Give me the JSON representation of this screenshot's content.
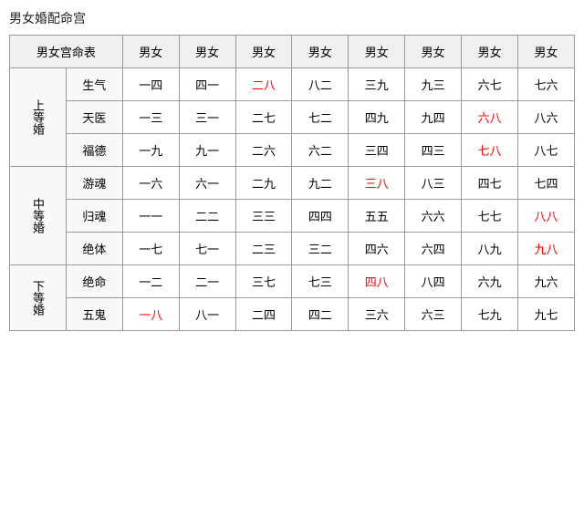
{
  "title": "男女婚配命宫",
  "table": {
    "topHeader": [
      "男女宫命表",
      "男女",
      "男女",
      "男女",
      "男女",
      "男女",
      "男女",
      "男女",
      "男女"
    ],
    "groups": [
      {
        "groupLabel": "上等婚",
        "rows": [
          {
            "rowLabel": "生气",
            "cells": [
              {
                "text": "一四",
                "red": false
              },
              {
                "text": "四一",
                "red": false
              },
              {
                "text": "二八",
                "red": true
              },
              {
                "text": "八二",
                "red": false
              },
              {
                "text": "三九",
                "red": false
              },
              {
                "text": "九三",
                "red": false
              },
              {
                "text": "六七",
                "red": false
              },
              {
                "text": "七六",
                "red": false
              }
            ]
          },
          {
            "rowLabel": "天医",
            "cells": [
              {
                "text": "一三",
                "red": false
              },
              {
                "text": "三一",
                "red": false
              },
              {
                "text": "二七",
                "red": false
              },
              {
                "text": "七二",
                "red": false
              },
              {
                "text": "四九",
                "red": false
              },
              {
                "text": "九四",
                "red": false
              },
              {
                "text": "六八",
                "red": true
              },
              {
                "text": "八六",
                "red": false
              }
            ]
          },
          {
            "rowLabel": "福德",
            "cells": [
              {
                "text": "一九",
                "red": false
              },
              {
                "text": "九一",
                "red": false
              },
              {
                "text": "二六",
                "red": false
              },
              {
                "text": "六二",
                "red": false
              },
              {
                "text": "三四",
                "red": false
              },
              {
                "text": "四三",
                "red": false
              },
              {
                "text": "七八",
                "red": true
              },
              {
                "text": "八七",
                "red": false
              }
            ]
          }
        ]
      },
      {
        "groupLabel": "中等婚",
        "rows": [
          {
            "rowLabel": "游魂",
            "cells": [
              {
                "text": "一六",
                "red": false
              },
              {
                "text": "六一",
                "red": false
              },
              {
                "text": "二九",
                "red": false
              },
              {
                "text": "九二",
                "red": false
              },
              {
                "text": "三八",
                "red": true
              },
              {
                "text": "八三",
                "red": false
              },
              {
                "text": "四七",
                "red": false
              },
              {
                "text": "七四",
                "red": false
              }
            ]
          },
          {
            "rowLabel": "归魂",
            "cells": [
              {
                "text": "一一",
                "red": false
              },
              {
                "text": "二二",
                "red": false
              },
              {
                "text": "三三",
                "red": false
              },
              {
                "text": "四四",
                "red": false
              },
              {
                "text": "五五",
                "red": false
              },
              {
                "text": "六六",
                "red": false
              },
              {
                "text": "七七",
                "red": false
              },
              {
                "text": "八八",
                "red": true
              }
            ]
          },
          {
            "rowLabel": "绝体",
            "cells": [
              {
                "text": "一七",
                "red": false
              },
              {
                "text": "七一",
                "red": false
              },
              {
                "text": "二三",
                "red": false
              },
              {
                "text": "三二",
                "red": false
              },
              {
                "text": "四六",
                "red": false
              },
              {
                "text": "六四",
                "red": false
              },
              {
                "text": "八九",
                "red": false
              },
              {
                "text": "九八",
                "red": true
              }
            ]
          }
        ]
      },
      {
        "groupLabel": "下等婚",
        "rows": [
          {
            "rowLabel": "绝命",
            "cells": [
              {
                "text": "一二",
                "red": false
              },
              {
                "text": "二一",
                "red": false
              },
              {
                "text": "三七",
                "red": false
              },
              {
                "text": "七三",
                "red": false
              },
              {
                "text": "四八",
                "red": true
              },
              {
                "text": "八四",
                "red": false
              },
              {
                "text": "六九",
                "red": false
              },
              {
                "text": "九六",
                "red": false
              }
            ]
          },
          {
            "rowLabel": "五鬼",
            "cells": [
              {
                "text": "一八",
                "red": true
              },
              {
                "text": "八一",
                "red": false
              },
              {
                "text": "二四",
                "red": false
              },
              {
                "text": "四二",
                "red": false
              },
              {
                "text": "三六",
                "red": false
              },
              {
                "text": "六三",
                "red": false
              },
              {
                "text": "七九",
                "red": false
              },
              {
                "text": "九七",
                "red": false
              }
            ]
          }
        ]
      }
    ]
  }
}
